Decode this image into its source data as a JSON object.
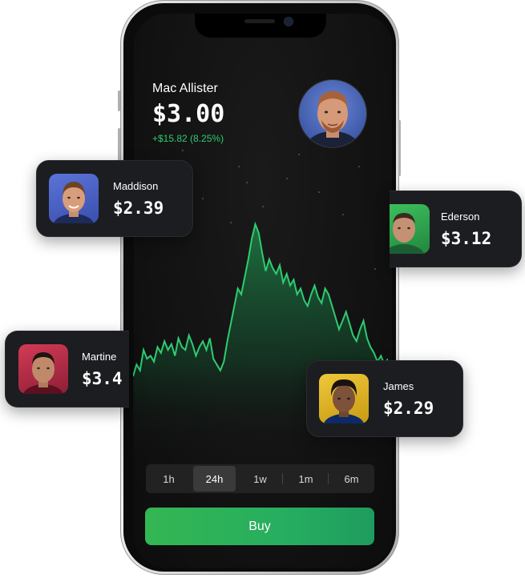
{
  "main_player": {
    "name": "Mac Allister",
    "price": "$3.00",
    "change": "+$15.82 (8.25%)",
    "avatar_icon": "player-avatar-mac-allister"
  },
  "cards": [
    {
      "name": "Maddison",
      "price": "$2.39",
      "avatar_icon": "player-avatar-maddison",
      "avatar_bg": "#4a63c7"
    },
    {
      "name": "Ederson",
      "price": "$3.12",
      "avatar_icon": "player-avatar-ederson",
      "avatar_bg": "#2e9e4b"
    },
    {
      "name": "Martine",
      "price": "$3.4",
      "avatar_icon": "player-avatar-martinelli",
      "avatar_bg": "#c2334b"
    },
    {
      "name": "James",
      "price": "$2.29",
      "avatar_icon": "player-avatar-james",
      "avatar_bg": "#e0b526"
    }
  ],
  "chart": {
    "line_color": "#2ecc71",
    "values": [
      48,
      52,
      50,
      57,
      54,
      55,
      53,
      58,
      56,
      60,
      57,
      59,
      55,
      61,
      58,
      57,
      62,
      59,
      55,
      58,
      60,
      57,
      61,
      54,
      52,
      50,
      53,
      60,
      66,
      72,
      78,
      76,
      82,
      88,
      95,
      100,
      97,
      90,
      84,
      88,
      85,
      83,
      86,
      80,
      83,
      79,
      81,
      76,
      78,
      74,
      72,
      76,
      79,
      75,
      73,
      78,
      76,
      72,
      68,
      64,
      67,
      70,
      66,
      62,
      60,
      64,
      67,
      61,
      58,
      56,
      53,
      55,
      52,
      54
    ]
  },
  "periods": [
    {
      "label": "1h",
      "active": false
    },
    {
      "label": "24h",
      "active": true
    },
    {
      "label": "1w",
      "active": false
    },
    {
      "label": "1m",
      "active": false
    },
    {
      "label": "6m",
      "active": false
    }
  ],
  "buy_button": {
    "label": "Buy"
  },
  "colors": {
    "accent_green": "#2ecc71",
    "screen_bg": "#121212",
    "card_bg": "#1c1d20"
  }
}
